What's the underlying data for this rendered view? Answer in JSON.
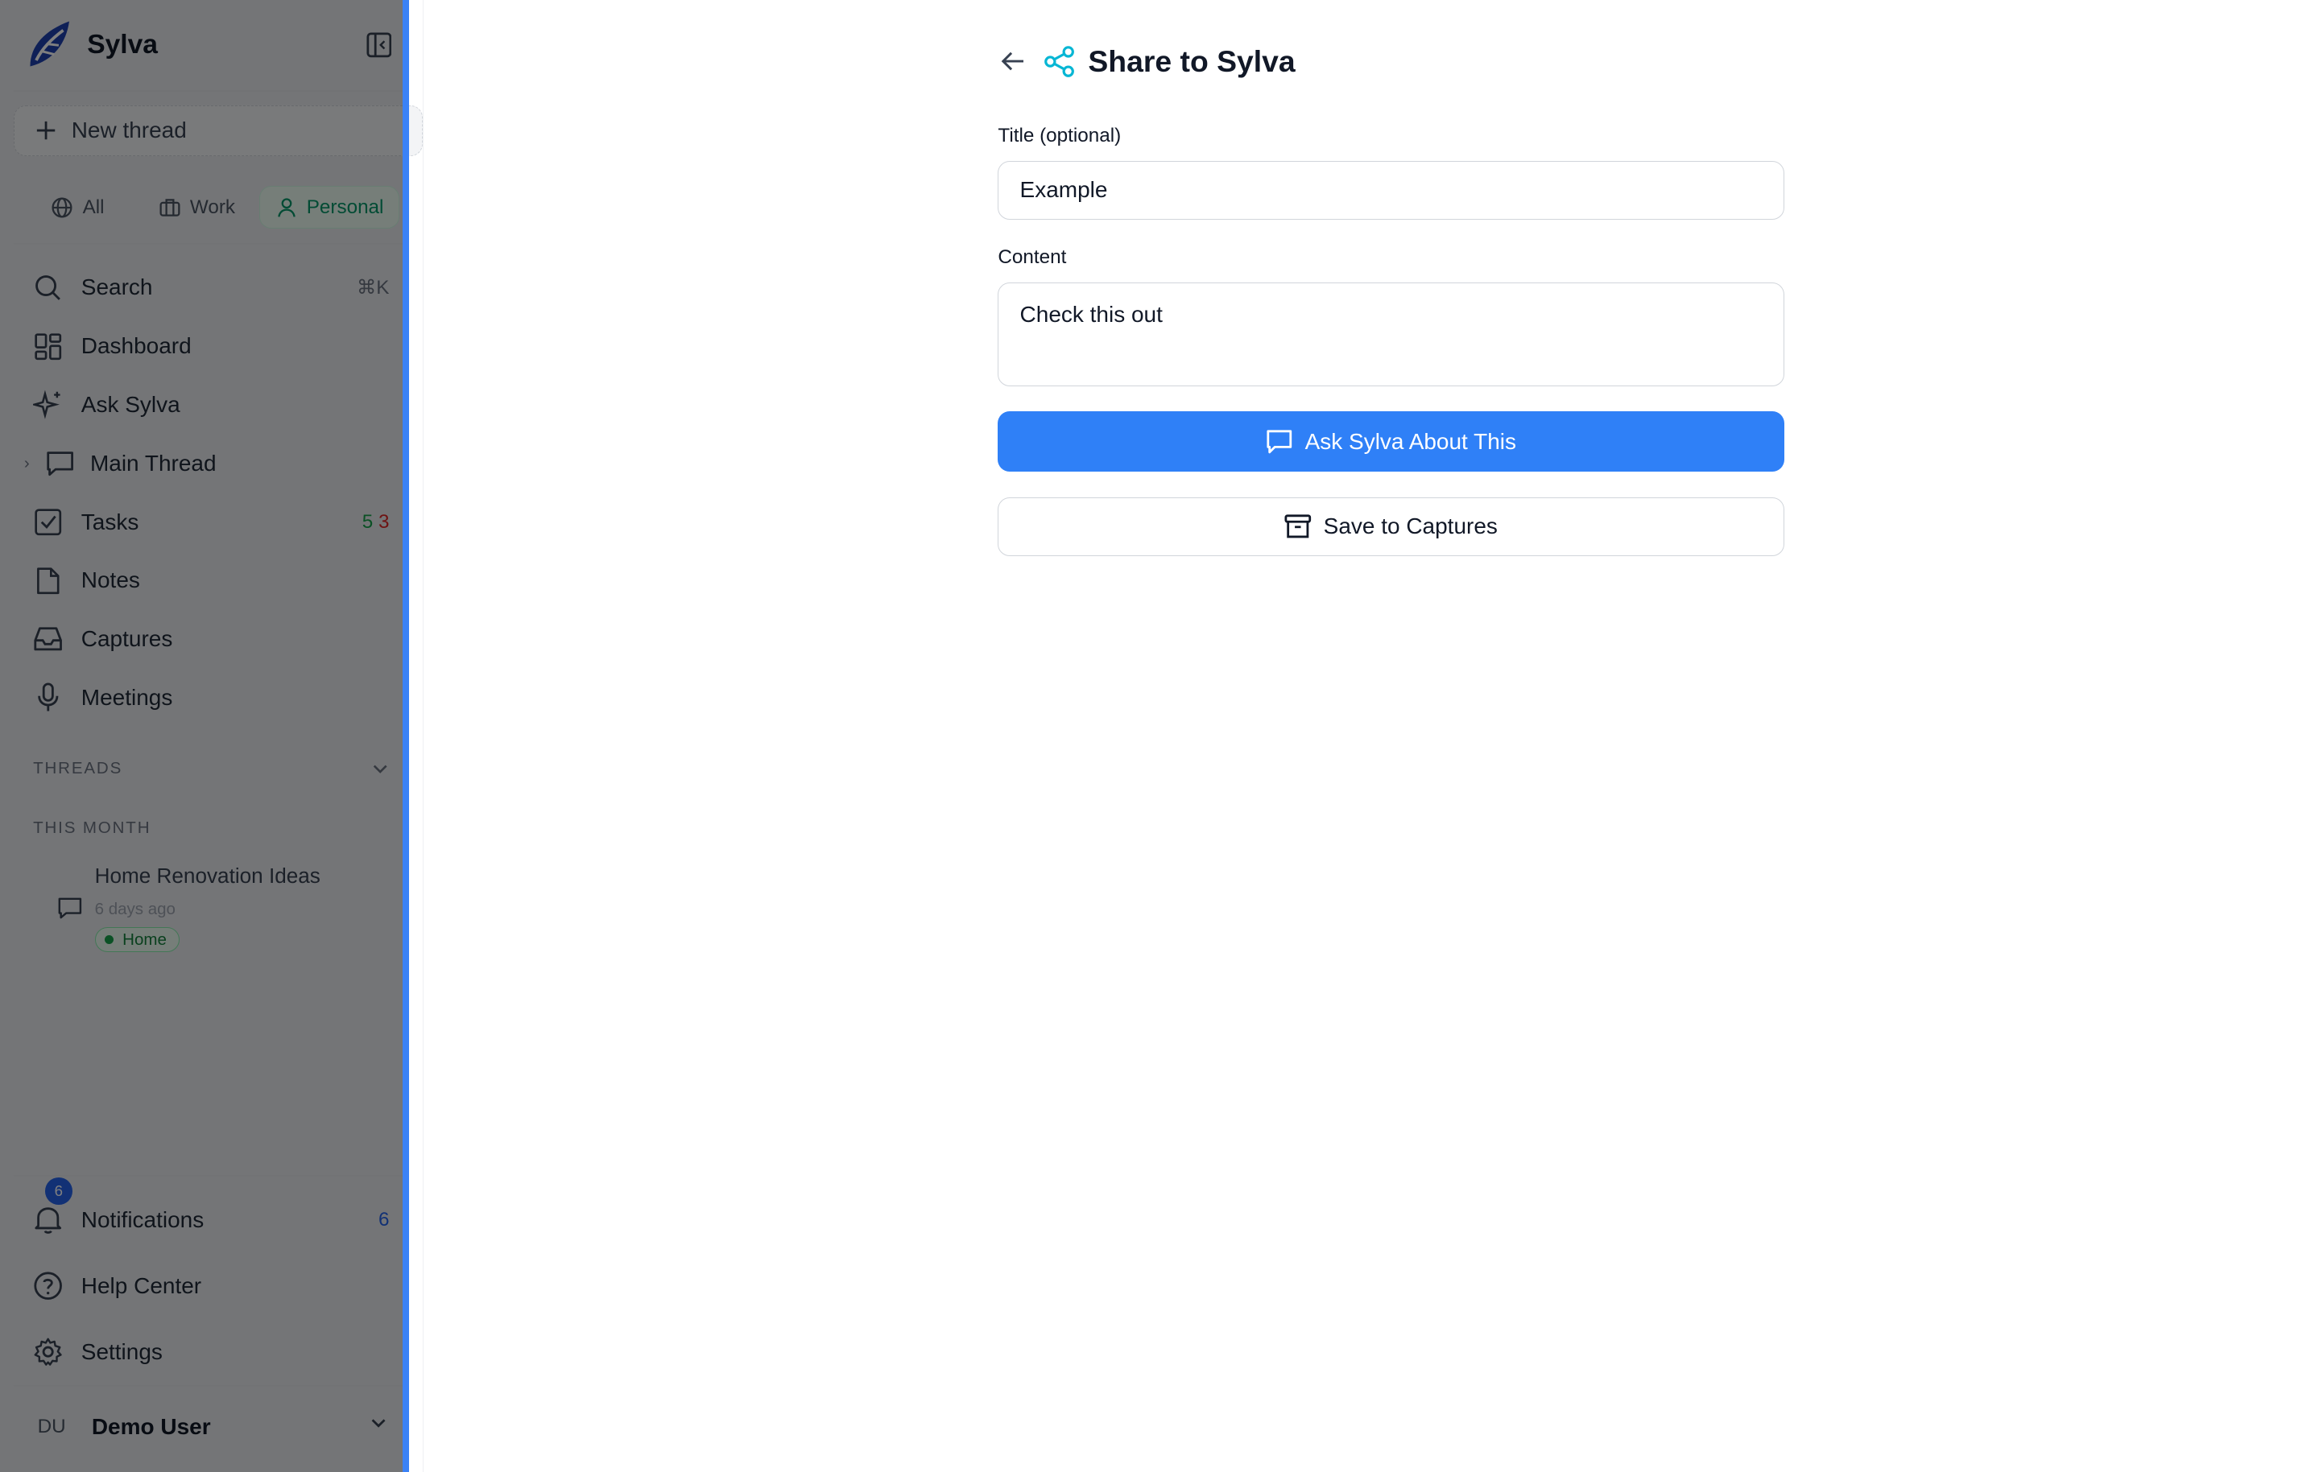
{
  "app": {
    "name": "Sylva"
  },
  "sidebar": {
    "new_thread_label": "New thread",
    "scopes": [
      {
        "label": "All",
        "icon": "globe-icon"
      },
      {
        "label": "Work",
        "icon": "briefcase-icon"
      },
      {
        "label": "Personal",
        "icon": "user-icon",
        "active": true
      }
    ],
    "nav": {
      "search": {
        "label": "Search",
        "shortcut": "⌘K"
      },
      "dashboard": {
        "label": "Dashboard"
      },
      "ask": {
        "label": "Ask Sylva"
      },
      "main_thread": {
        "label": "Main Thread"
      },
      "tasks": {
        "label": "Tasks",
        "count_open": "5",
        "count_overdue": "3"
      },
      "notes": {
        "label": "Notes"
      },
      "captures": {
        "label": "Captures"
      },
      "meetings": {
        "label": "Meetings"
      }
    },
    "threads_section_label": "THREADS",
    "period_label": "THIS MONTH",
    "threads": [
      {
        "title": "Home Renovation Ideas",
        "time": "6 days ago",
        "tag": "Home"
      }
    ],
    "bottom": {
      "notifications": {
        "label": "Notifications",
        "badge": "6",
        "count": "6"
      },
      "help": {
        "label": "Help Center"
      },
      "settings": {
        "label": "Settings"
      }
    },
    "user": {
      "initials": "DU",
      "name": "Demo User"
    }
  },
  "share": {
    "title": "Share to Sylva",
    "title_field": {
      "label": "Title (optional)",
      "value": "Example"
    },
    "content_field": {
      "label": "Content",
      "value": "Check this out"
    },
    "ask_button": "Ask Sylva About This",
    "save_button": "Save to Captures"
  },
  "colors": {
    "accent": "#2f80f7",
    "resize_handle": "#3b82f6",
    "personal_active": "#059669",
    "tasks_open": "#16a34a",
    "tasks_overdue": "#dc2626",
    "share_icon": "#06b6d4"
  }
}
